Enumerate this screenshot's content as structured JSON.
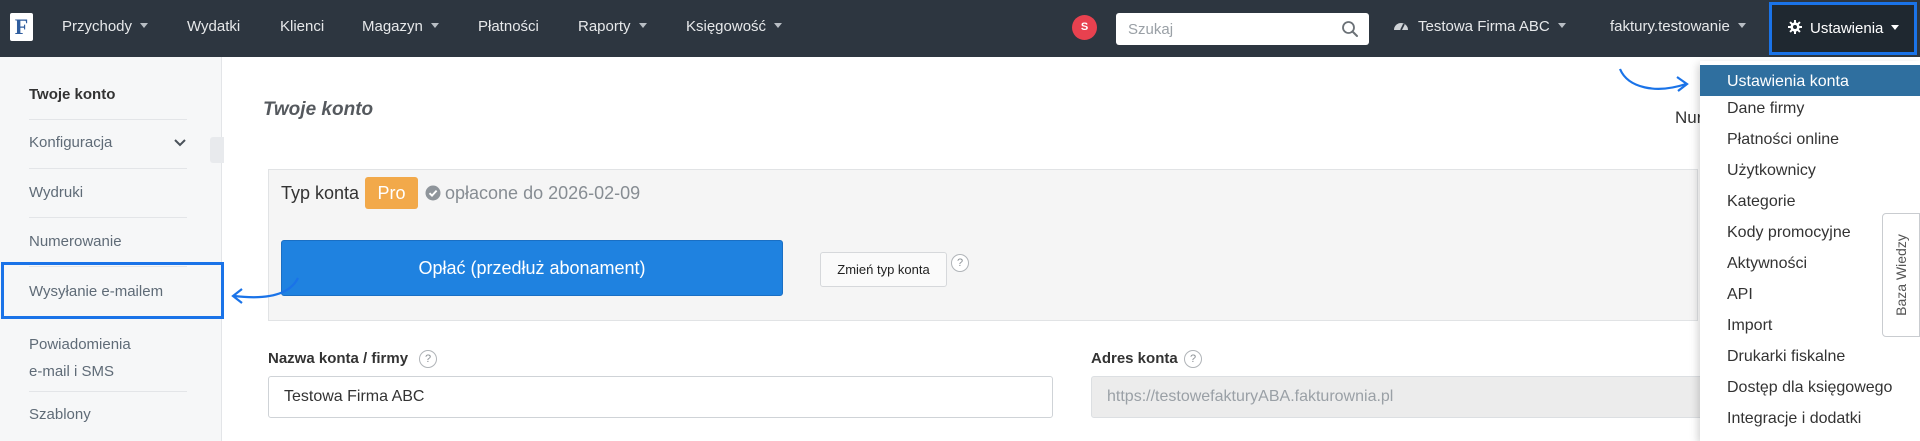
{
  "navbar": {
    "logo": "F",
    "items": [
      {
        "label": "Przychody",
        "dropdown": true
      },
      {
        "label": "Wydatki",
        "dropdown": false
      },
      {
        "label": "Klienci",
        "dropdown": false
      },
      {
        "label": "Magazyn",
        "dropdown": true
      },
      {
        "label": "Płatności",
        "dropdown": false
      },
      {
        "label": "Raporty",
        "dropdown": true
      },
      {
        "label": "Księgowość",
        "dropdown": true
      }
    ],
    "notification_badge": "S",
    "search_placeholder": "Szukaj",
    "company": "Testowa Firma ABC",
    "user": "faktury.testowanie",
    "settings": "Ustawienia"
  },
  "sidebar": {
    "items": [
      {
        "label": "Twoje konto"
      },
      {
        "label": "Konfiguracja"
      },
      {
        "label": "Wydruki"
      },
      {
        "label": "Numerowanie"
      },
      {
        "label": "Wysyłanie e-mailem"
      },
      {
        "label_line1": "Powiadomienia",
        "label_line2": "e-mail i SMS"
      },
      {
        "label": "Szablony"
      }
    ]
  },
  "main": {
    "title": "Twoje konto",
    "numbering_clip": "Nur",
    "account_type_label": "Typ konta",
    "account_type": "Pro",
    "paid_until": "opłacone do 2026-02-09",
    "pay_button": "Opłać (przedłuż abonament)",
    "change_button": "Zmień typ konta",
    "help": "?",
    "account_name_label": "Nazwa konta / firmy",
    "account_name_value": "Testowa Firma ABC",
    "account_address_label": "Adres konta",
    "account_address_value": "https://testowefakturyABA.fakturownia.pl"
  },
  "dropdown": {
    "items": [
      "Ustawienia konta",
      "Dane firmy",
      "Płatności online",
      "Użytkownicy",
      "Kategorie",
      "Kody promocyjne",
      "Aktywności",
      "API",
      "Import",
      "Drukarki fiskalne",
      "Dostęp dla księgowego",
      "Integracje i dodatki"
    ],
    "active_index": 0
  },
  "side_tab": "Baza Wiedzy",
  "colors": {
    "navbar_bg": "#2d3640",
    "highlight": "#1a73e8",
    "pro_badge": "#f2a94a",
    "pay_button": "#1f82e0",
    "dropdown_active": "#2f6f9f",
    "badge": "#e8414f"
  }
}
